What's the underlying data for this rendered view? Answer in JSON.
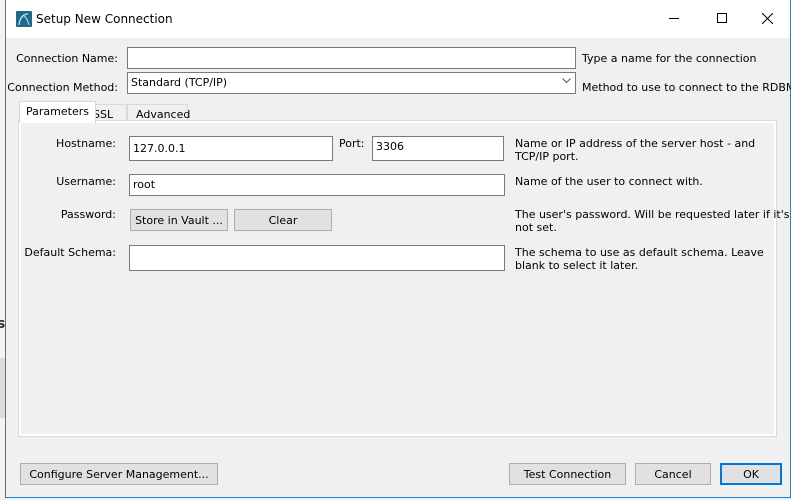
{
  "window": {
    "title": "Setup New Connection",
    "controls": {
      "minimize": "minimize",
      "maximize": "maximize",
      "close": "close"
    }
  },
  "background": {
    "partial_letter": "s"
  },
  "connection": {
    "name_label": "Connection Name:",
    "name_value": "",
    "name_help": "Type a name for the connection",
    "method_label": "Connection Method:",
    "method_value": "Standard (TCP/IP)",
    "method_help": "Method to use to connect to the RDBMS"
  },
  "tabs": [
    {
      "label": "Parameters",
      "active": true
    },
    {
      "label": "SSL",
      "active": false
    },
    {
      "label": "Advanced",
      "active": false
    }
  ],
  "parameters": {
    "hostname_label": "Hostname:",
    "hostname_value": "127.0.0.1",
    "port_label": "Port:",
    "port_value": "3306",
    "hostname_help_line1": "Name or IP address of the server host - and",
    "hostname_help_line2": "TCP/IP port.",
    "username_label": "Username:",
    "username_value": "root",
    "username_help": "Name of the user to connect with.",
    "password_label": "Password:",
    "store_vault_label": "Store in Vault ...",
    "clear_label": "Clear",
    "password_help_line1": "The user's password. Will be requested later if it's",
    "password_help_line2": "not set.",
    "schema_label": "Default Schema:",
    "schema_value": "",
    "schema_help_line1": "The schema to use as default schema. Leave",
    "schema_help_line2": "blank to select it later."
  },
  "footer": {
    "configure_label": "Configure Server Management...",
    "test_label": "Test Connection",
    "cancel_label": "Cancel",
    "ok_label": "OK"
  },
  "colors": {
    "accent": "#0078d7",
    "window_border": "#1883d7",
    "app_icon": "#1d6a8c"
  }
}
